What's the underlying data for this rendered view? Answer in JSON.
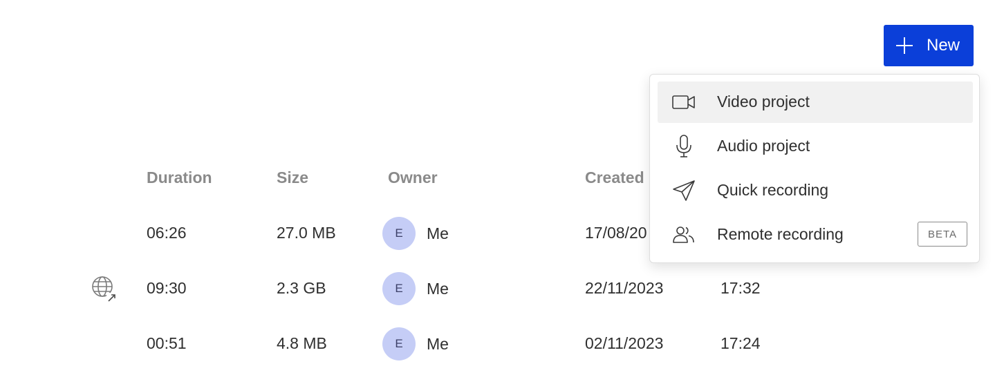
{
  "new_button": {
    "label": "New",
    "icon": "plus-icon",
    "background_color": "#0b3fd9"
  },
  "table": {
    "columns": [
      "Duration",
      "Size",
      "Owner",
      "Created"
    ],
    "rows": [
      {
        "duration": "06:26",
        "size": "27.0 MB",
        "owner_initial": "E",
        "owner_name": "Me",
        "created_date": "17/08/20",
        "created_time": "",
        "public": false
      },
      {
        "duration": "09:30",
        "size": "2.3 GB",
        "owner_initial": "E",
        "owner_name": "Me",
        "created_date": "22/11/2023",
        "created_time": "17:32",
        "public": true
      },
      {
        "duration": "00:51",
        "size": "4.8 MB",
        "owner_initial": "E",
        "owner_name": "Me",
        "created_date": "02/11/2023",
        "created_time": "17:24",
        "public": false
      }
    ]
  },
  "dropdown": {
    "items": [
      {
        "label": "Video project",
        "icon": "video-camera-icon",
        "active": true
      },
      {
        "label": "Audio project",
        "icon": "microphone-icon",
        "active": false
      },
      {
        "label": "Quick recording",
        "icon": "send-icon",
        "active": false
      },
      {
        "label": "Remote recording",
        "icon": "users-icon",
        "active": false,
        "badge": "BETA"
      }
    ]
  },
  "colors": {
    "accent": "#0b3fd9",
    "avatar_bg": "#c5cdf6",
    "header_text": "#8a8a8a",
    "menu_hover": "#f1f1f1"
  }
}
